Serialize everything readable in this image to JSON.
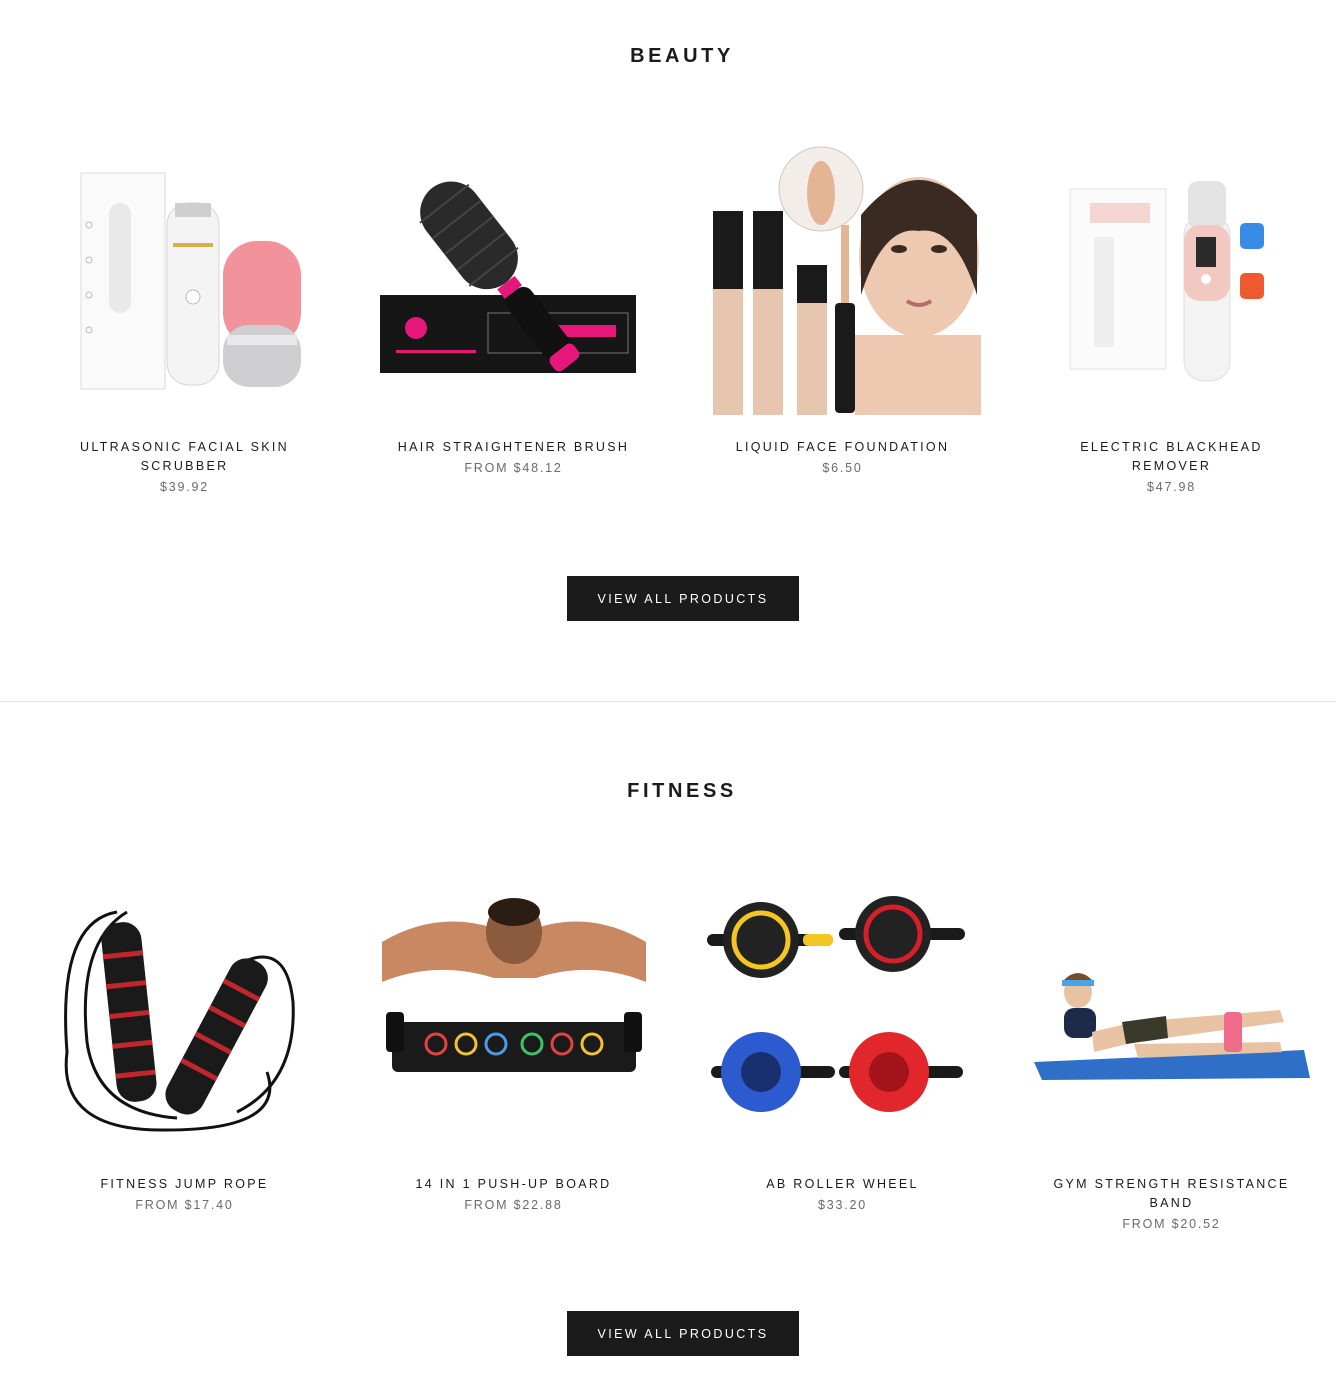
{
  "beauty": {
    "title": "Beauty",
    "button_label": "View all products",
    "products": [
      {
        "name": "Ultrasonic Facial Skin Scrubber",
        "price": "$39.92",
        "image": "facial-scrubber-image"
      },
      {
        "name": "Hair Straightener Brush",
        "price": "From $48.12",
        "image": "hair-brush-image"
      },
      {
        "name": "Liquid Face Foundation",
        "price": "$6.50",
        "image": "foundation-image"
      },
      {
        "name": "Electric Blackhead Remover",
        "price": "$47.98",
        "image": "blackhead-remover-image"
      }
    ]
  },
  "fitness": {
    "title": "Fitness",
    "button_label": "View all products",
    "products": [
      {
        "name": "Fitness Jump Rope",
        "price": "From $17.40",
        "image": "jump-rope-image"
      },
      {
        "name": "14 in 1 Push-Up Board",
        "price": "From $22.88",
        "image": "pushup-board-image"
      },
      {
        "name": "AB Roller Wheel",
        "price": "$33.20",
        "image": "ab-roller-image"
      },
      {
        "name": "Gym Strength Resistance Band",
        "price": "From $20.52",
        "image": "resistance-band-image"
      }
    ]
  },
  "colors": {
    "button_bg": "#1c1b1b",
    "button_text": "#ffffff",
    "price_text": "#6a6a6a",
    "divider": "#e3e3e3"
  }
}
